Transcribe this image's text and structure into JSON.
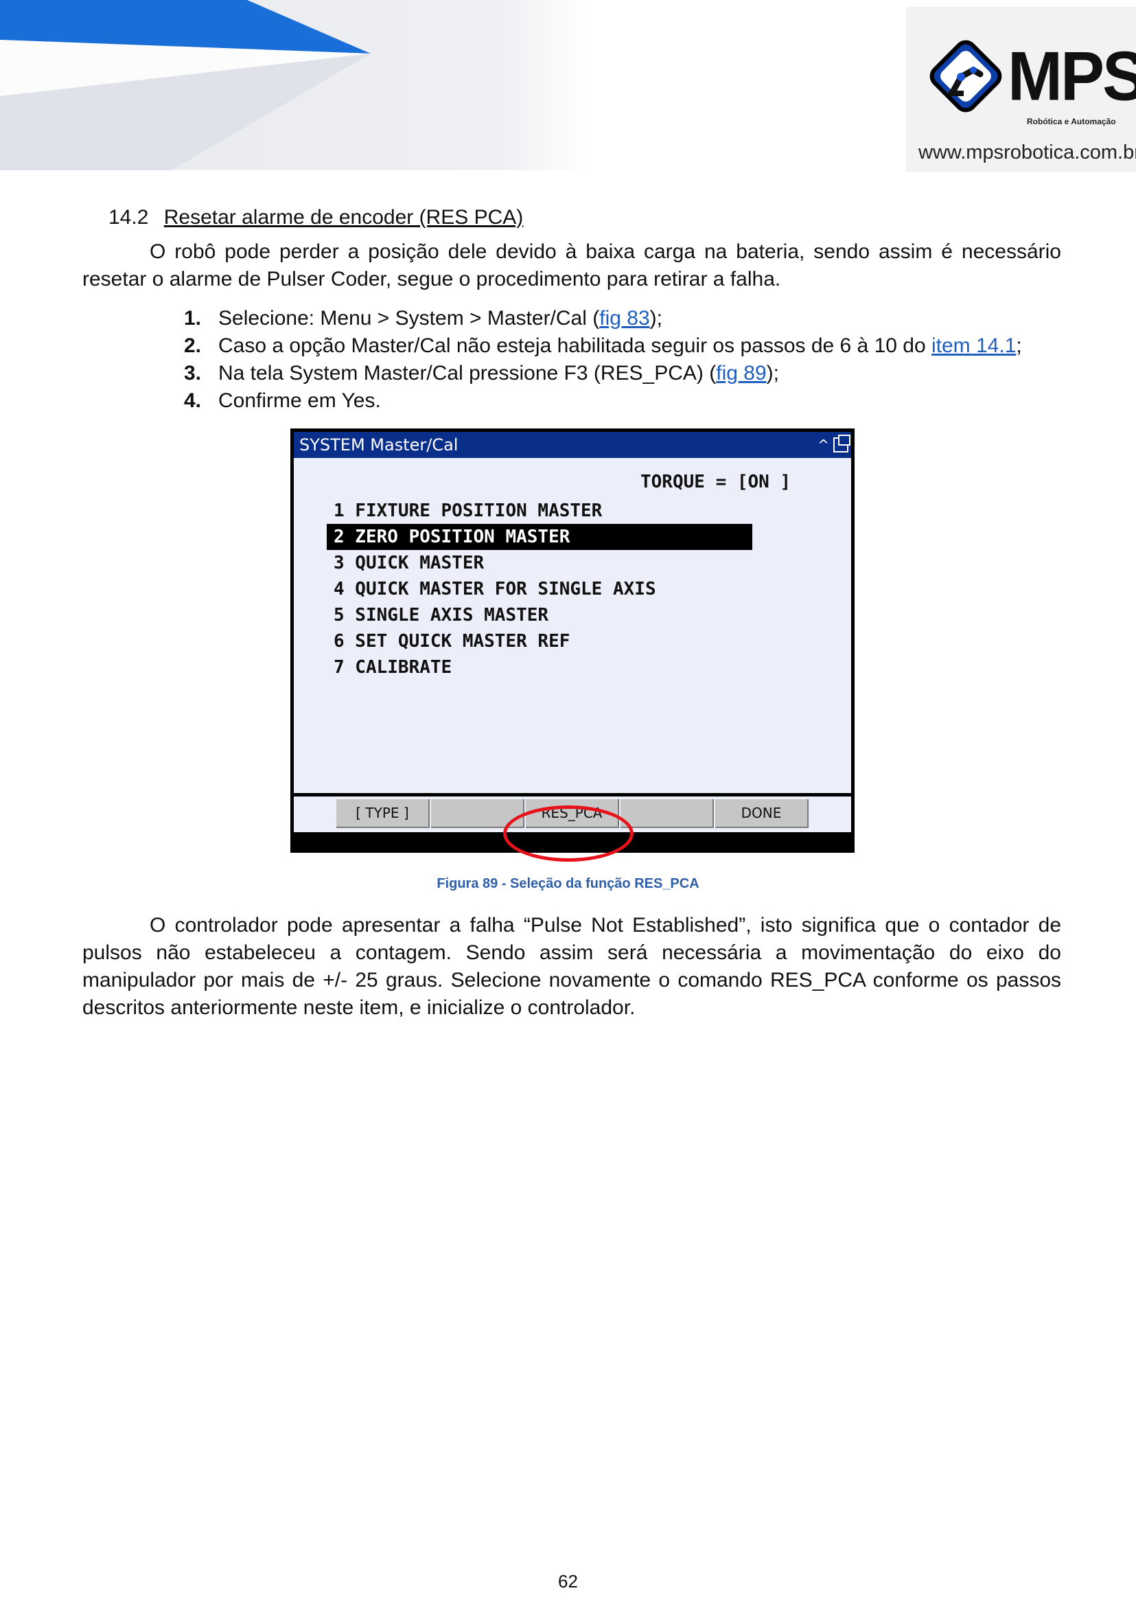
{
  "header": {
    "logo_text": "MPS",
    "logo_subtitle": "Robótica e Automação",
    "website": "www.mpsrobotica.com.br",
    "brand_color": "#1a56d6"
  },
  "section": {
    "number": "14.2",
    "title": "Resetar alarme de encoder (RES PCA)"
  },
  "intro_paragraph": "O robô pode perder a posição dele devido à baixa carga na bateria, sendo assim é necessário resetar o alarme de Pulser Coder, segue o procedimento para retirar a falha.",
  "steps": [
    {
      "num": "1.",
      "before": "Selecione: Menu > System > Master/Cal (",
      "link": "fig 83",
      "after": ");"
    },
    {
      "num": "2.",
      "before": "Caso a opção Master/Cal não esteja habilitada seguir os passos de 6 à 10 do ",
      "link": "item 14.1",
      "after": ";"
    },
    {
      "num": "3.",
      "before": "Na tela System Master/Cal pressione F3 (RES_PCA) (",
      "link": "fig 89",
      "after": ");"
    },
    {
      "num": "4.",
      "before": "Confirme em Yes.",
      "link": "",
      "after": ""
    }
  ],
  "pendant": {
    "title": "SYSTEM Master/Cal",
    "torque": "TORQUE = [ON ]",
    "menu": [
      "1 FIXTURE POSITION MASTER",
      "2 ZERO POSITION MASTER",
      "3 QUICK MASTER",
      "4 QUICK MASTER FOR SINGLE AXIS",
      "5 SINGLE AXIS MASTER",
      "6 SET QUICK MASTER REF",
      "7 CALIBRATE"
    ],
    "selected_index": 1,
    "function_keys": [
      "[ TYPE ]",
      "",
      "RES_PCA",
      "",
      "DONE"
    ],
    "highlight_color": "#e8121a"
  },
  "figure_caption": "Figura 89 - Seleção da função RES_PCA",
  "closing_paragraph": "O controlador pode apresentar a falha “Pulse Not Established”, isto significa que o contador de pulsos não estabeleceu a contagem. Sendo assim será necessária a movimentação do eixo do manipulador por mais de +/- 25 graus. Selecione novamente o comando RES_PCA conforme os passos descritos anteriormente neste item, e inicialize o controlador.",
  "page_number": "62"
}
